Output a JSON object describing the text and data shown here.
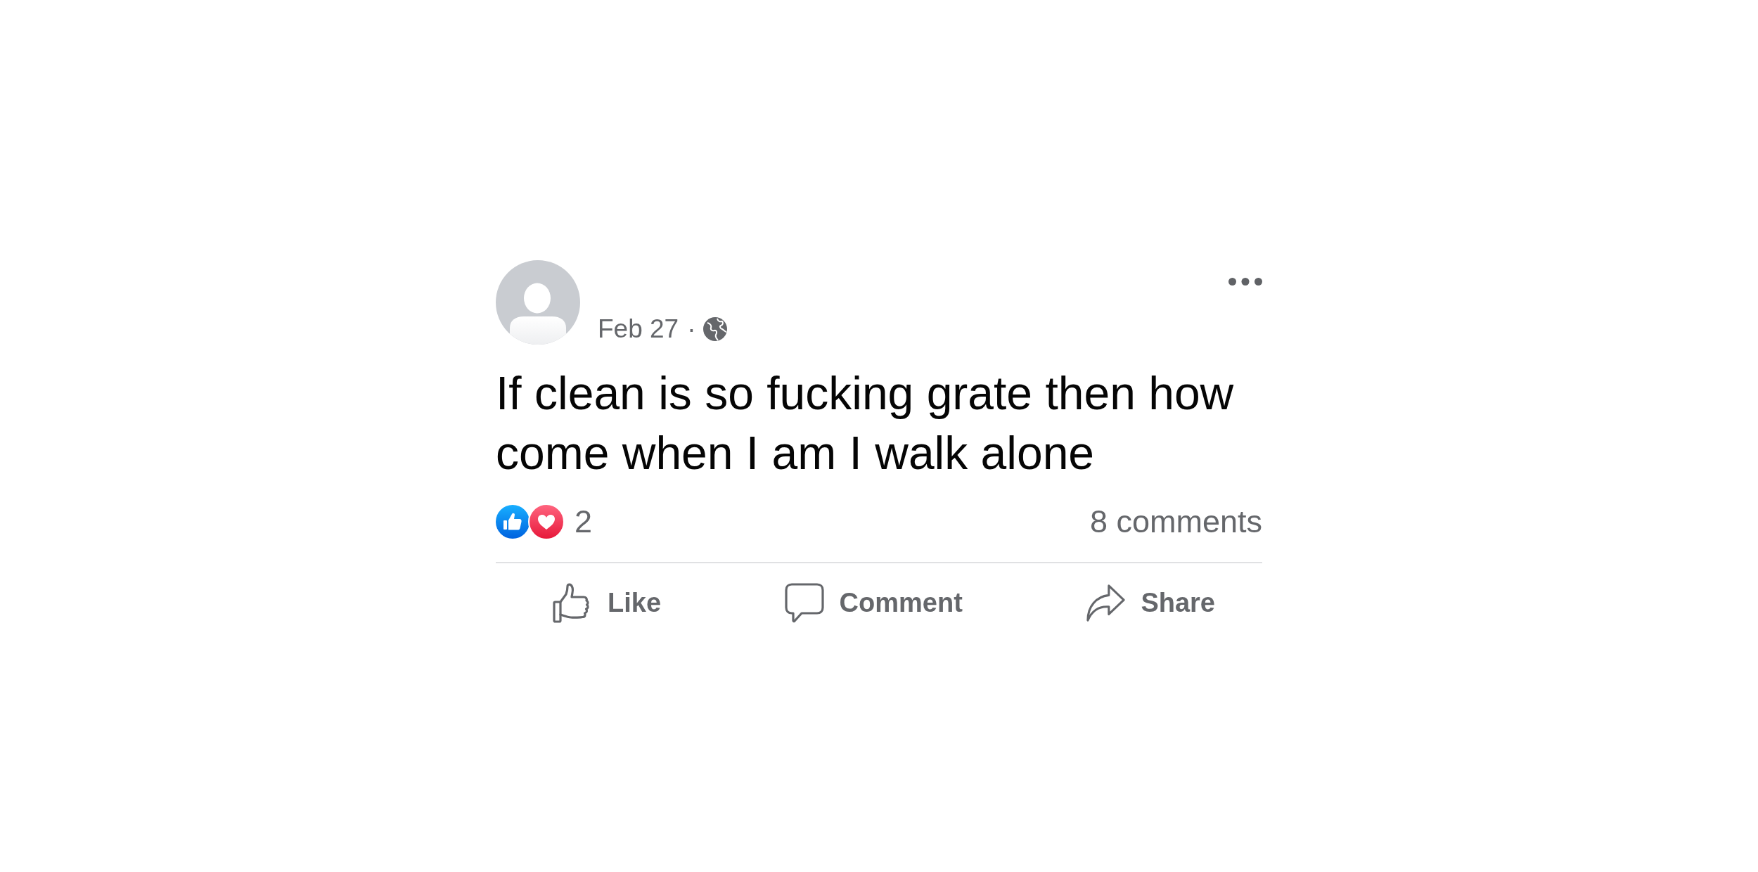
{
  "post": {
    "date": "Feb 27",
    "separator": "·",
    "text": "If clean is so fucking grate then how come when I am I walk alone",
    "reactions": [
      {
        "kind": "like"
      },
      {
        "kind": "love"
      }
    ],
    "reaction_count": "2",
    "comment_count": "8 comments",
    "actions": [
      {
        "kind": "like",
        "label": "Like"
      },
      {
        "kind": "comment",
        "label": "Comment"
      },
      {
        "kind": "share",
        "label": "Share"
      }
    ]
  }
}
